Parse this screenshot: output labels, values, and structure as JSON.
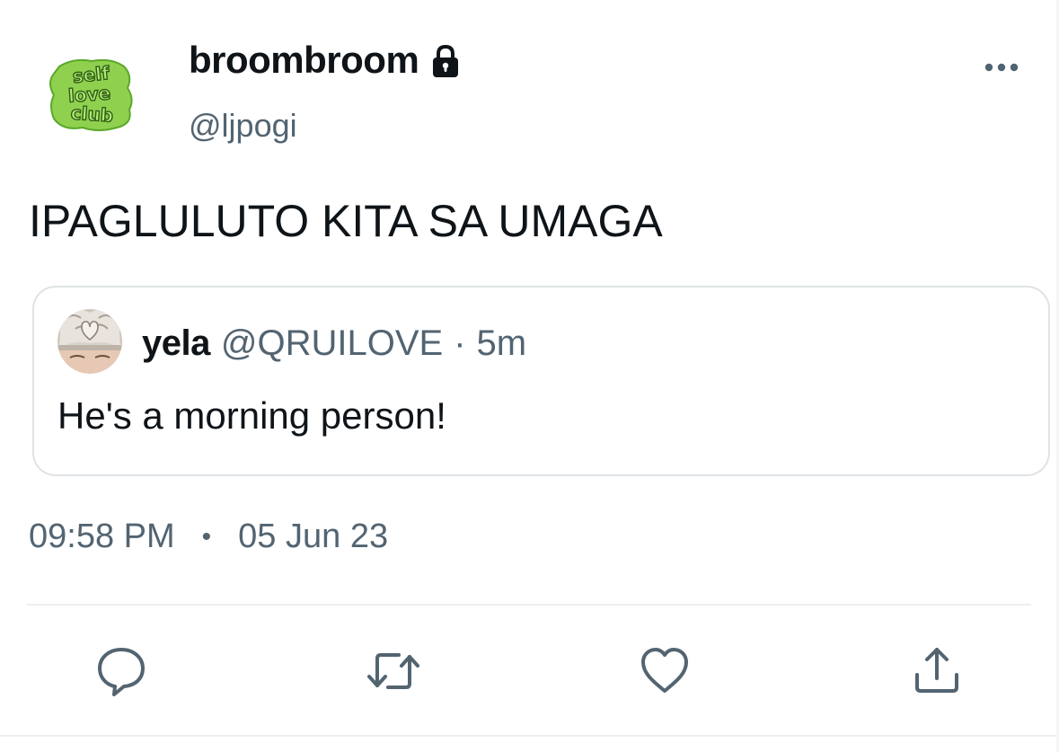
{
  "author": {
    "display_name": "broombroom",
    "handle": "@ljpogi",
    "avatar_logo_text": [
      "self",
      "love",
      "club"
    ],
    "protected_icon": "lock-icon"
  },
  "tweet": {
    "text": "IPAGLULUTO KITA SA UMAGA",
    "time": "09:58 PM",
    "separator": "•",
    "date": "05 Jun 23"
  },
  "quoted_tweet": {
    "display_name": "yela",
    "handle": "@QRUILOVE",
    "separator": "·",
    "relative_time": "5m",
    "text": "He's a morning person!"
  },
  "actions": [
    {
      "name": "reply",
      "icon": "reply-icon"
    },
    {
      "name": "retweet",
      "icon": "retweet-icon"
    },
    {
      "name": "like",
      "icon": "heart-icon"
    },
    {
      "name": "share",
      "icon": "share-icon"
    }
  ],
  "colors": {
    "text_primary": "#0f1419",
    "text_secondary": "#536471",
    "border": "#dfe3e6",
    "logo_green": "#8fd14f",
    "logo_outline": "#2e5d12"
  }
}
